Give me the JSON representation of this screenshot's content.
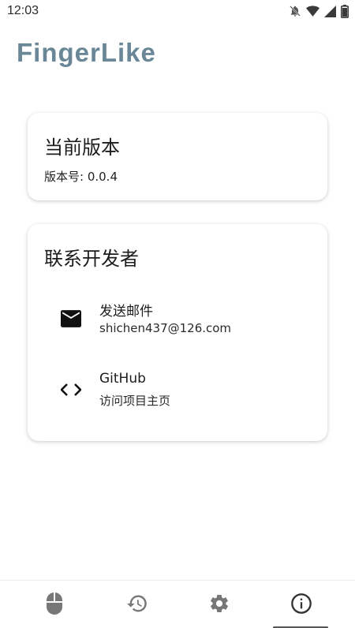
{
  "status_bar": {
    "time": "12:03",
    "icons": [
      "notifications-off-icon",
      "wifi-icon",
      "signal-icon",
      "battery-icon"
    ]
  },
  "app": {
    "title": "FingerLike",
    "title_color": "#6a8798"
  },
  "version_card": {
    "title": "当前版本",
    "version_text": "版本号: 0.0.4"
  },
  "contact_card": {
    "title": "联系开发者",
    "items": [
      {
        "icon": "mail-icon",
        "title": "发送邮件",
        "subtitle": "shichen437@126.com"
      },
      {
        "icon": "code-icon",
        "title": "GitHub",
        "subtitle": "访问项目主页"
      }
    ]
  },
  "bottom_nav": {
    "items": [
      {
        "icon": "mouse-icon",
        "selected": false
      },
      {
        "icon": "history-icon",
        "selected": false
      },
      {
        "icon": "settings-icon",
        "selected": false
      },
      {
        "icon": "info-icon",
        "selected": true
      }
    ]
  }
}
